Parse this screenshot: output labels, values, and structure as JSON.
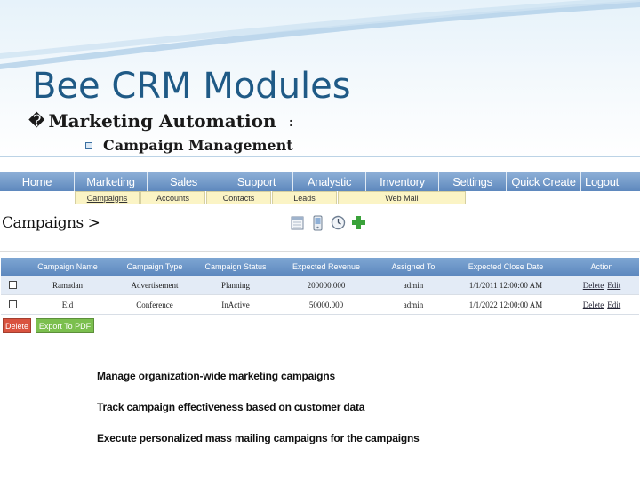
{
  "slide": {
    "title": "Bee CRM Modules",
    "bullet1_glyph": "�",
    "bullet1": "Marketing Automation",
    "bullet1_suffix": ":",
    "bullet2": "Campaign Management"
  },
  "nav": {
    "items": [
      "Home",
      "Marketing",
      "Sales",
      "Support",
      "Analystic",
      "Inventory",
      "Settings",
      "Quick Create",
      "Logout"
    ],
    "sub_items": [
      "Campaigns",
      "Accounts",
      "Contacts",
      "Leads",
      "Web Mail"
    ]
  },
  "campaigns": {
    "title": "Campaigns >",
    "icons": [
      "calendar-icon",
      "mobile-icon",
      "clock-icon",
      "add-icon"
    ],
    "columns": [
      "Campaign Name",
      "Campaign Type",
      "Campaign Status",
      "Expected Revenue",
      "Assigned To",
      "Expected Close Date",
      "Action"
    ],
    "rows": [
      {
        "name": "Ramadan",
        "type": "Advertisement",
        "status": "Planning",
        "revenue": "200000.000",
        "assigned": "admin",
        "close_date": "1/1/2011 12:00:00 AM",
        "delete": "Delete",
        "edit": "Edit"
      },
      {
        "name": "Eid",
        "type": "Conference",
        "status": "InActive",
        "revenue": "50000.000",
        "assigned": "admin",
        "close_date": "1/1/2022 12:00:00 AM",
        "delete": "Delete",
        "edit": "Edit"
      }
    ],
    "buttons": {
      "delete": "Delete",
      "export_pdf": "Export To PDF"
    }
  },
  "features": [
    "Manage organization-wide marketing campaigns",
    "Track campaign effectiveness based on customer data",
    "Execute personalized mass mailing campaigns for the campaigns"
  ],
  "colors": {
    "title": "#1f5a86",
    "nav_bar": "#6d95c8",
    "sub_tab": "#fbf4c5",
    "row_alt": "#e3ebf6",
    "delete_button": "#d9533f",
    "export_button": "#7bbf4e"
  }
}
